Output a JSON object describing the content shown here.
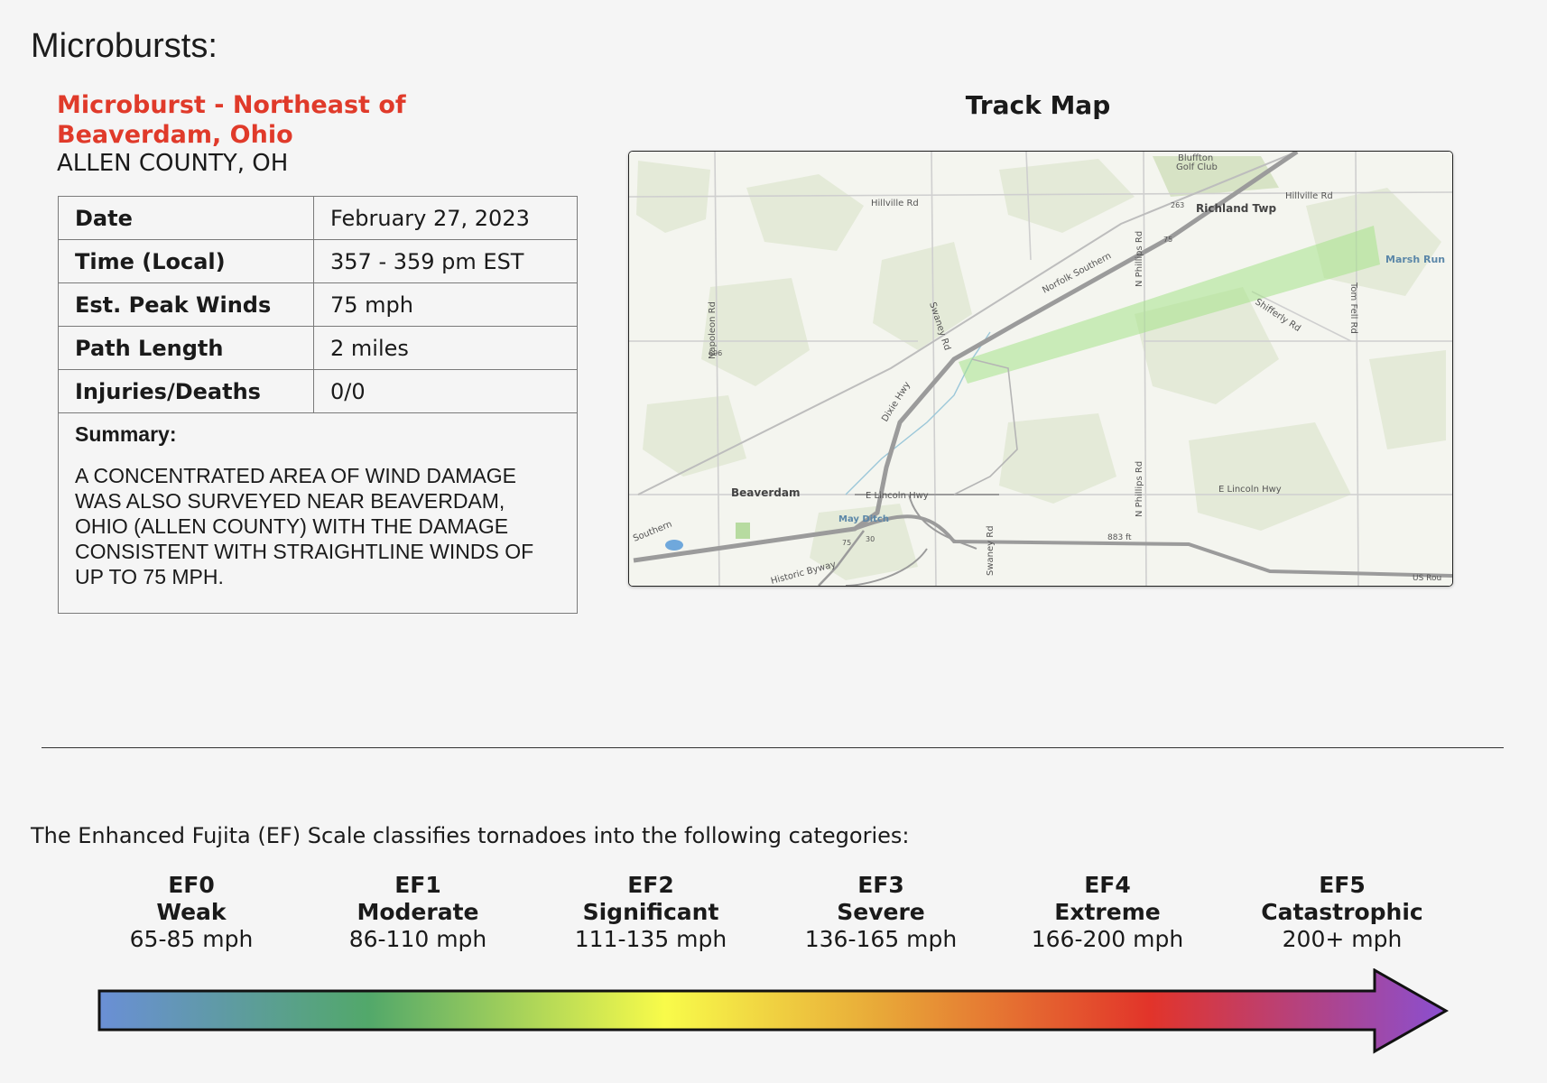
{
  "section_title": "Microbursts:",
  "event": {
    "name": "Microburst - Northeast of Beaverdam, Ohio",
    "county": "ALLEN COUNTY, OH",
    "rows": [
      {
        "label": "Date",
        "value": "February 27, 2023"
      },
      {
        "label": "Time (Local)",
        "value": "357 - 359 pm EST"
      },
      {
        "label": "Est. Peak Winds",
        "value": "75 mph"
      },
      {
        "label": "Path Length",
        "value": "2 miles"
      },
      {
        "label": "Injuries/Deaths",
        "value": "0/0"
      }
    ],
    "summary_label": "Summary:",
    "summary_text": "A CONCENTRATED AREA OF WIND DAMAGE WAS ALSO SURVEYED NEAR BEAVERDAM, OHIO (ALLEN COUNTY) WITH THE DAMAGE CONSISTENT WITH STRAIGHTLINE WINDS OF UP TO 75 MPH."
  },
  "track_map": {
    "title": "Track Map",
    "labels": {
      "golf_club_1": "Bluffton",
      "golf_club_2": "Golf Club",
      "hillville_rd_west": "Hillville Rd",
      "hillville_rd_east": "Hillville Rd",
      "route_263": "263",
      "richland_twp": "Richland Twp",
      "route_75_north": "75",
      "norfolk_southern": "Norfolk Southern",
      "n_phillips_rd_north": "N Phillips Rd",
      "tom_fell_rd": "Tom Fell Rd",
      "marsh_run": "Marsh Run",
      "shifferly_rd": "Shifferly Rd",
      "napoleon_rd": "Napoleon Rd",
      "route_696": "696",
      "swaney_rd_north": "Swaney Rd",
      "dixie_hwy": "Dixie Hwy",
      "beaverdam": "Beaverdam",
      "e_lincoln_hwy_west": "E Lincoln Hwy",
      "e_lincoln_hwy_east": "E Lincoln Hwy",
      "may_ditch": "May Ditch",
      "route_75_south": "75",
      "route_30": "30",
      "elevation": "883 ft",
      "n_phillips_rd_south": "N Phillips Rd",
      "swaney_rd_south": "Swaney Rd",
      "southern": "Southern",
      "historic_byway": "Historic Byway",
      "us_route": "US Rou"
    },
    "colors": {
      "damage_path": "#a6e28a",
      "base": "#f4f5ef",
      "woods": "#e3e9d6",
      "road": "#9b9b9b",
      "water": "#6fa8dc"
    }
  },
  "ef_scale": {
    "intro": "The Enhanced Fujita (EF) Scale classifies tornadoes into the following categories:",
    "categories": [
      {
        "cat": "EF0",
        "desc": "Weak",
        "speed": "65-85 mph"
      },
      {
        "cat": "EF1",
        "desc": "Moderate",
        "speed": "86-110 mph"
      },
      {
        "cat": "EF2",
        "desc": "Significant",
        "speed": "111-135 mph"
      },
      {
        "cat": "EF3",
        "desc": "Severe",
        "speed": "136-165 mph"
      },
      {
        "cat": "EF4",
        "desc": "Extreme",
        "speed": "166-200 mph"
      },
      {
        "cat": "EF5",
        "desc": "Catastrophic",
        "speed": "200+ mph"
      }
    ],
    "gradient_colors": [
      "#6a8fd6",
      "#52a86a",
      "#f8fb4a",
      "#e8a838",
      "#e2342a",
      "#8a4fd0"
    ]
  }
}
